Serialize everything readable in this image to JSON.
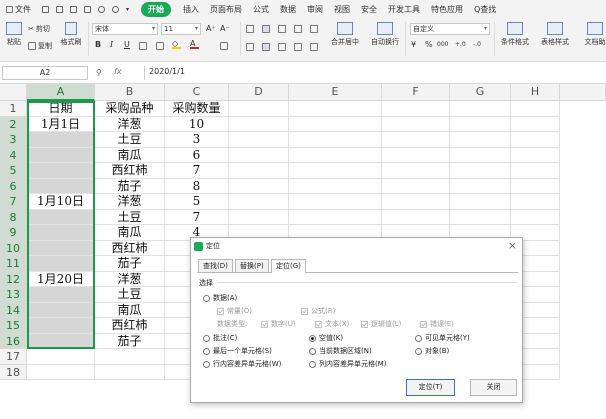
{
  "menubar": {
    "file": "文件",
    "tabs": [
      "开始",
      "插入",
      "页面布局",
      "公式",
      "数据",
      "审阅",
      "视图",
      "安全",
      "开发工具",
      "特色应用"
    ],
    "search": "Q查找"
  },
  "ribbon": {
    "paste": "粘贴",
    "cut": "剪切",
    "copy": "复制",
    "format_painter": "格式刷",
    "font_name": "宋体",
    "font_size": "11",
    "bold": "B",
    "italic": "I",
    "underline": "U",
    "grow_font": "A⁺",
    "shrink_font": "A⁻",
    "merge_center": "合并居中",
    "wrap_text": "自动换行",
    "number_format": "自定义",
    "currency": "¥",
    "percent": "%",
    "thousands": "000",
    "dec_increase": "+.0",
    "dec_decrease": "-.0",
    "conditional_format": "条件格式",
    "table_style": "表格样式",
    "doc_assist": "文档助",
    "accent_font_color": "#d42020",
    "accent_fill_color": "#f5d000"
  },
  "formula_bar": {
    "name_box": "A2",
    "fx": "fx",
    "content": "2020/1/1"
  },
  "sheet": {
    "columns": [
      "A",
      "B",
      "C",
      "D",
      "E",
      "F",
      "G",
      "H"
    ],
    "rows": [
      [
        "日期",
        "采购品种",
        "采购数量"
      ],
      [
        "1月1日",
        "洋葱",
        "10"
      ],
      [
        "",
        "土豆",
        "3"
      ],
      [
        "",
        "南瓜",
        "6"
      ],
      [
        "",
        "西红柿",
        "7"
      ],
      [
        "",
        "茄子",
        "8"
      ],
      [
        "1月10日",
        "洋葱",
        "5"
      ],
      [
        "",
        "土豆",
        "7"
      ],
      [
        "",
        "南瓜",
        "4"
      ],
      [
        "",
        "西红柿",
        ""
      ],
      [
        "",
        "茄子",
        ""
      ],
      [
        "1月20日",
        "洋葱",
        ""
      ],
      [
        "",
        "土豆",
        ""
      ],
      [
        "",
        "南瓜",
        ""
      ],
      [
        "",
        "西红柿",
        ""
      ],
      [
        "",
        "茄子",
        ""
      ],
      [
        "",
        "",
        ""
      ],
      [
        "",
        "",
        ""
      ]
    ],
    "row_numbers": [
      "1",
      "2",
      "3",
      "4",
      "5",
      "6",
      "7",
      "8",
      "9",
      "10",
      "11",
      "12",
      "13",
      "14",
      "15",
      "16",
      "17",
      "18"
    ],
    "selected_column": "A",
    "selection_color": "#1a9a4a"
  },
  "dialog": {
    "title": "定位",
    "close": "×",
    "tabs": [
      "查找(D)",
      "替换(P)",
      "定位(G)"
    ],
    "active_tab": "定位(G)",
    "section": "选择",
    "data_option": "数据(A)",
    "constant": "常量(O)",
    "formula": "公式(R)",
    "data_type_label": "数据类型:",
    "types": [
      "数字(U)",
      "文本(X)",
      "逻辑值(L)",
      "错误(E)"
    ],
    "options": [
      "批注(C)",
      "空值(K)",
      "可见单元格(Y)",
      "最后一个单元格(S)",
      "当前数据区域(N)",
      "对象(B)",
      "行内容差异单元格(W)",
      "列内容差异单元格(M)"
    ],
    "selected_option": "空值(K)",
    "ok_button": "定位(T)",
    "close_button": "关闭"
  }
}
